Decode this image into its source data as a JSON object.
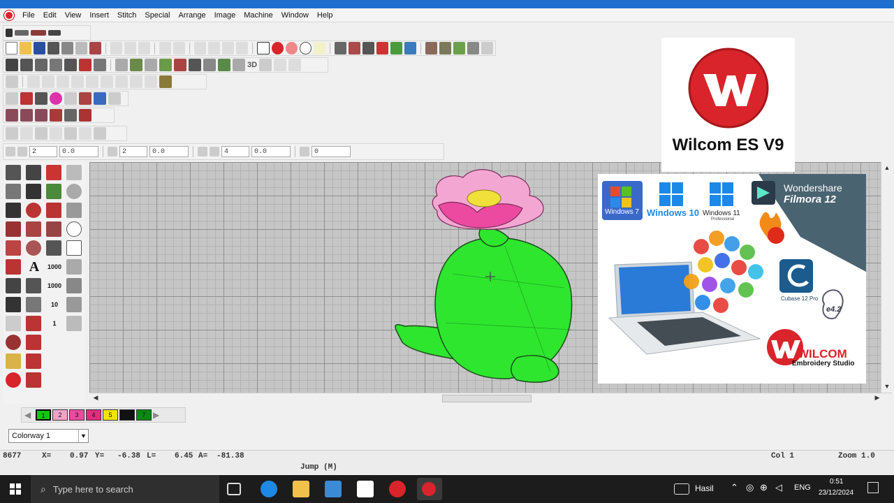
{
  "menu": [
    "File",
    "Edit",
    "View",
    "Insert",
    "Stitch",
    "Special",
    "Arrange",
    "Image",
    "Machine",
    "Window",
    "Help"
  ],
  "toolbar_fields": {
    "f1": "2",
    "f2": "0.0",
    "f3": "2",
    "f4": "0.0",
    "f5": "4",
    "f6": "0.0",
    "f7": "0",
    "toolbar_3d": "3D"
  },
  "lefttool_labels": {
    "a": "A",
    "n1000": "1000",
    "n10": "10",
    "n1": "1"
  },
  "palette": {
    "swatches": [
      {
        "label": "1",
        "color": "#11c711"
      },
      {
        "label": "2",
        "color": "#f2a2c8"
      },
      {
        "label": "3",
        "color": "#ec4aa0"
      },
      {
        "label": "4",
        "color": "#e12c7f"
      },
      {
        "label": "5",
        "color": "#f2e400"
      },
      {
        "label": "",
        "color": "#111111"
      },
      {
        "label": "7",
        "color": "#0a8a12"
      }
    ]
  },
  "colorway": {
    "value": "Colorway 1"
  },
  "status": {
    "stitch": "8677",
    "x_label": "X=",
    "x": "0.97",
    "y_label": "Y=",
    "y": "-6.38",
    "l_label": "L=",
    "l": "6.45",
    "a_label": "A=",
    "a": "-81.38",
    "col": "Col 1",
    "zoom": "Zoom 1.0",
    "prompt": "Jump (M)"
  },
  "taskbar": {
    "search_placeholder": "Type here to search",
    "weather": "Hasil",
    "lang": "ENG",
    "time": "0:51",
    "date": "23/12/2024"
  },
  "overlay": {
    "logo_title": "Wilcom ES V9",
    "win7": "Windows 7",
    "win10": "Windows 10",
    "win11": "Windows 11",
    "win11_sub": "Professional",
    "filmora_brand": "Wondershare",
    "filmora_name": "Filmora 12",
    "cubase": "Cubase 12 Pro",
    "e42": "e4.2",
    "wilcom_brand": "WILCOM",
    "wilcom_sub": "Embroidery Studio"
  },
  "colors": {
    "cactus": "#2ee62e",
    "petal": "#f4a6d2",
    "center": "#f2e03a",
    "wilcom_red": "#d8242a"
  }
}
